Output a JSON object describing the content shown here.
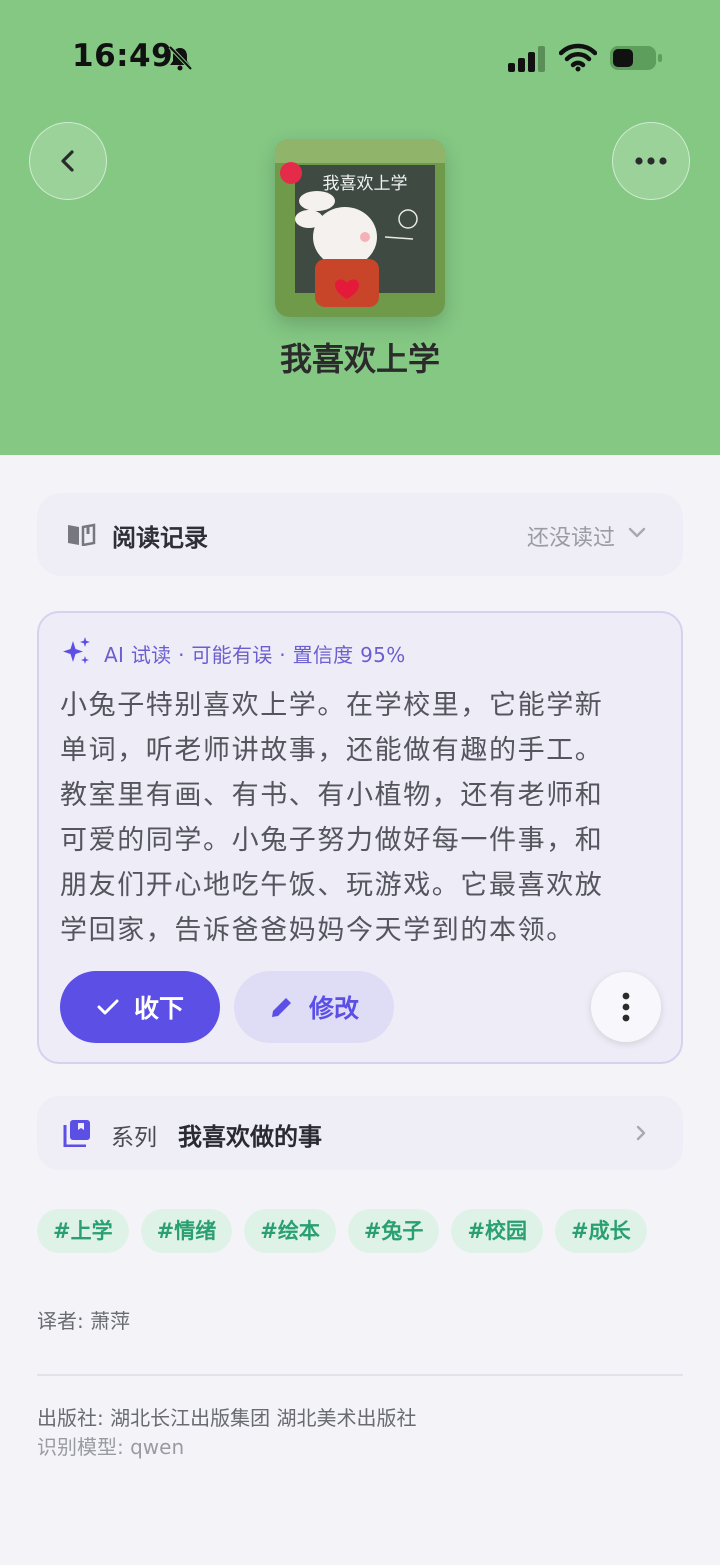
{
  "status_bar": {
    "time": "16:49"
  },
  "book": {
    "title": "我喜欢上学",
    "cover_title": "我喜欢上学"
  },
  "reading_record": {
    "label": "阅读记录",
    "status": "还没读过"
  },
  "ai_preview": {
    "meta": "AI 试读 · 可能有误 · 置信度 95%",
    "lines": [
      "小兔子特别喜欢上学。在学校里，它能学新",
      "单词，听老师讲故事，还能做有趣的手工。",
      "教室里有画、有书、有小植物，还有老师和",
      "可爱的同学。小兔子努力做好每一件事，和",
      "朋友们开心地吃午饭、玩游戏。它最喜欢放",
      "学回家，告诉爸爸妈妈今天学到的本领。"
    ],
    "accept_label": "收下",
    "edit_label": "修改"
  },
  "series": {
    "label": "系列",
    "name": "我喜欢做的事"
  },
  "tags": [
    "#上学",
    "#情绪",
    "#绘本",
    "#兔子",
    "#校园",
    "#成长"
  ],
  "meta": {
    "translator": "译者: 萧萍",
    "publisher": "出版社: 湖北长江出版集团 湖北美术出版社",
    "model": "识别模型: qwen"
  },
  "colors": {
    "header_bg": "#84c884",
    "accent": "#5b4fe6",
    "tag_text": "#2aa070"
  },
  "icons": [
    "bell-slash-icon",
    "signal-icon",
    "wifi-icon",
    "battery-icon",
    "back-icon",
    "more-icon",
    "book-open-icon",
    "chevron-down-icon",
    "sparkle-icon",
    "check-icon",
    "pencil-icon",
    "kebab-icon",
    "series-icon",
    "chevron-right-icon"
  ]
}
